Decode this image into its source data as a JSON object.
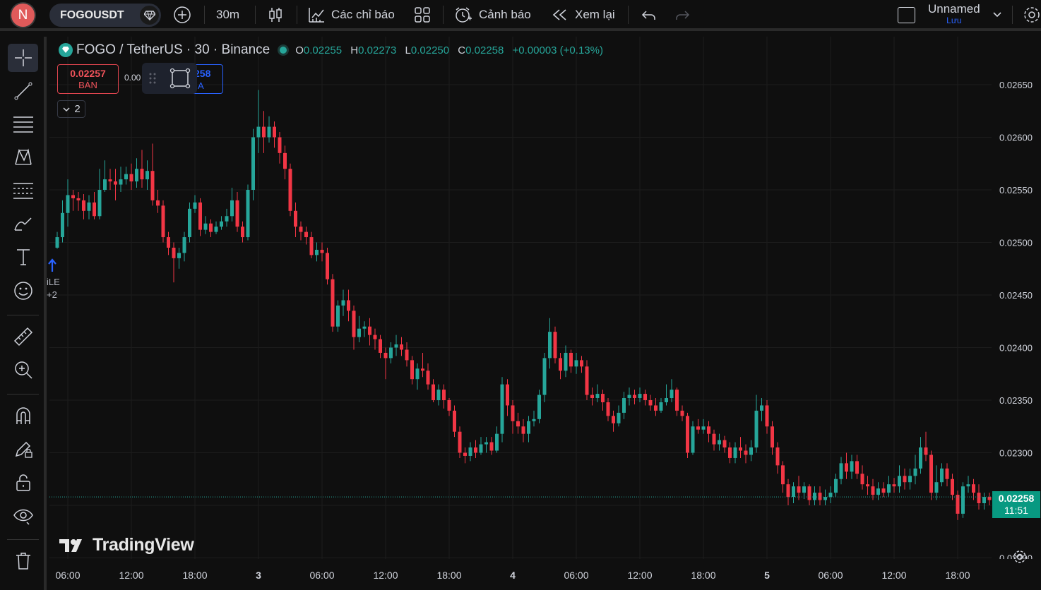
{
  "user": {
    "initial": "N"
  },
  "toolbar": {
    "symbol": "FOGOUSDT",
    "interval": "30m",
    "indicators_label": "Các chỉ báo",
    "alerts_label": "Cảnh báo",
    "replay_label": "Xem lại",
    "layout_name": "Unnamed",
    "save_label": "Lưu"
  },
  "legend": {
    "title": "FOGO / TetherUS · 30 · Binance",
    "o_label": "O",
    "o_value": "0.02255",
    "h_label": "H",
    "h_value": "0.02273",
    "l_label": "L",
    "l_value": "0.02250",
    "c_label": "C",
    "c_value": "0.02258",
    "change": "+0.00003 (+0.13%)"
  },
  "trade": {
    "sell_price": "0.02257",
    "sell_label": "BÁN",
    "spread": "0.00",
    "buy_price": "258",
    "buy_label": "A",
    "collapsed_count": "2"
  },
  "event": {
    "line1": "iLE",
    "line2": "+2"
  },
  "watermark": "TradingView",
  "current_price": {
    "value": "0.02258",
    "countdown": "11:51"
  },
  "colors": {
    "up": "#26a69a",
    "down": "#f23645",
    "bg": "#0f0f0f",
    "grid": "#1c1c1c",
    "accent": "#2962ff"
  },
  "chart_data": {
    "type": "candlestick",
    "ylim": [
      0.0222,
      0.0267
    ],
    "y_ticks": [
      "0.02650",
      "0.02600",
      "0.02550",
      "0.02500",
      "0.02450",
      "0.02400",
      "0.02350",
      "0.02300",
      "0.02250",
      "0.02200"
    ],
    "x_ticks": [
      "06:00",
      "12:00",
      "18:00",
      "3",
      "06:00",
      "12:00",
      "18:00",
      "4",
      "06:00",
      "12:00",
      "18:00",
      "5",
      "06:00",
      "12:00",
      "18:00"
    ],
    "bars_per_tick": 12,
    "first_tick_bar": 2,
    "candles": [
      [
        0.02495,
        0.02505,
        0.02494,
        0.0251
      ],
      [
        0.02505,
        0.02528,
        0.025,
        0.0254
      ],
      [
        0.02528,
        0.02545,
        0.02515,
        0.0256
      ],
      [
        0.02545,
        0.02542,
        0.0253,
        0.0255
      ],
      [
        0.02542,
        0.0254,
        0.0253,
        0.02548
      ],
      [
        0.0254,
        0.0253,
        0.02522,
        0.02546
      ],
      [
        0.0253,
        0.02538,
        0.02522,
        0.02545
      ],
      [
        0.02538,
        0.02525,
        0.02522,
        0.02548
      ],
      [
        0.02525,
        0.0255,
        0.02522,
        0.0257
      ],
      [
        0.0255,
        0.0256,
        0.02548,
        0.02578
      ],
      [
        0.0256,
        0.02558,
        0.0255,
        0.0257
      ],
      [
        0.02558,
        0.02555,
        0.0254,
        0.0257
      ],
      [
        0.02555,
        0.0256,
        0.02548,
        0.02572
      ],
      [
        0.0256,
        0.02565,
        0.02555,
        0.02572
      ],
      [
        0.02565,
        0.02558,
        0.0255,
        0.02575
      ],
      [
        0.02558,
        0.0257,
        0.02552,
        0.0258
      ],
      [
        0.0257,
        0.0256,
        0.02552,
        0.02588
      ],
      [
        0.0256,
        0.02568,
        0.0255,
        0.02578
      ],
      [
        0.02568,
        0.0254,
        0.02535,
        0.02594
      ],
      [
        0.0254,
        0.02535,
        0.02528,
        0.0255
      ],
      [
        0.02535,
        0.02505,
        0.025,
        0.0254
      ],
      [
        0.02505,
        0.02495,
        0.02488,
        0.0251
      ],
      [
        0.02495,
        0.02485,
        0.02462,
        0.025
      ],
      [
        0.02485,
        0.0249,
        0.02475,
        0.02495
      ],
      [
        0.0249,
        0.02505,
        0.02482,
        0.0251
      ],
      [
        0.02505,
        0.02532,
        0.025,
        0.02538
      ],
      [
        0.02532,
        0.02538,
        0.02528,
        0.02545
      ],
      [
        0.02538,
        0.02512,
        0.02506,
        0.02542
      ],
      [
        0.02512,
        0.02518,
        0.02508,
        0.02525
      ],
      [
        0.02518,
        0.0251,
        0.02505,
        0.02522
      ],
      [
        0.0251,
        0.02515,
        0.02508,
        0.0252
      ],
      [
        0.02515,
        0.0252,
        0.02512,
        0.02525
      ],
      [
        0.0252,
        0.02525,
        0.02515,
        0.02532
      ],
      [
        0.02525,
        0.0254,
        0.0252,
        0.02552
      ],
      [
        0.0254,
        0.02515,
        0.0251,
        0.02548
      ],
      [
        0.02515,
        0.02505,
        0.025,
        0.0252
      ],
      [
        0.02505,
        0.0255,
        0.02502,
        0.02555
      ],
      [
        0.0255,
        0.026,
        0.0254,
        0.02608
      ],
      [
        0.026,
        0.0261,
        0.02585,
        0.02645
      ],
      [
        0.0261,
        0.026,
        0.02585,
        0.02625
      ],
      [
        0.026,
        0.0261,
        0.02595,
        0.0262
      ],
      [
        0.0261,
        0.026,
        0.0259,
        0.02615
      ],
      [
        0.026,
        0.02585,
        0.02575,
        0.02605
      ],
      [
        0.02585,
        0.0257,
        0.0256,
        0.02592
      ],
      [
        0.0257,
        0.0253,
        0.02525,
        0.02575
      ],
      [
        0.0253,
        0.02515,
        0.02505,
        0.02538
      ],
      [
        0.02515,
        0.0251,
        0.02502,
        0.0252
      ],
      [
        0.0251,
        0.02505,
        0.02498,
        0.02515
      ],
      [
        0.02505,
        0.02488,
        0.02485,
        0.0251
      ],
      [
        0.02488,
        0.02493,
        0.02482,
        0.025
      ],
      [
        0.02493,
        0.0249,
        0.02482,
        0.025
      ],
      [
        0.0249,
        0.02465,
        0.0246,
        0.02495
      ],
      [
        0.02465,
        0.0242,
        0.02415,
        0.0247
      ],
      [
        0.0242,
        0.0244,
        0.02415,
        0.02445
      ],
      [
        0.0244,
        0.02445,
        0.0243,
        0.02455
      ],
      [
        0.02445,
        0.02435,
        0.02425,
        0.02455
      ],
      [
        0.02435,
        0.0241,
        0.02398,
        0.0244
      ],
      [
        0.0241,
        0.02418,
        0.02405,
        0.0243
      ],
      [
        0.02418,
        0.0242,
        0.0241,
        0.02425
      ],
      [
        0.0242,
        0.02412,
        0.02402,
        0.02428
      ],
      [
        0.02412,
        0.02408,
        0.02398,
        0.02418
      ],
      [
        0.02408,
        0.02395,
        0.0239,
        0.02412
      ],
      [
        0.02395,
        0.0239,
        0.0237,
        0.024
      ],
      [
        0.0239,
        0.024,
        0.02385,
        0.02405
      ],
      [
        0.024,
        0.02403,
        0.02392,
        0.02412
      ],
      [
        0.02403,
        0.02398,
        0.02392,
        0.0241
      ],
      [
        0.02398,
        0.02388,
        0.02382,
        0.02405
      ],
      [
        0.02388,
        0.0237,
        0.02365,
        0.02392
      ],
      [
        0.0237,
        0.0238,
        0.0236,
        0.02385
      ],
      [
        0.0238,
        0.02378,
        0.02372,
        0.02395
      ],
      [
        0.02378,
        0.02365,
        0.0236,
        0.02385
      ],
      [
        0.02365,
        0.0235,
        0.02348,
        0.0237
      ],
      [
        0.0235,
        0.0236,
        0.02345,
        0.02365
      ],
      [
        0.0236,
        0.0235,
        0.02342,
        0.02365
      ],
      [
        0.0235,
        0.0234,
        0.02335,
        0.02352
      ],
      [
        0.0234,
        0.0232,
        0.02315,
        0.02345
      ],
      [
        0.0232,
        0.023,
        0.02295,
        0.02325
      ],
      [
        0.023,
        0.02297,
        0.0229,
        0.02305
      ],
      [
        0.02297,
        0.02305,
        0.02292,
        0.0231
      ],
      [
        0.02305,
        0.023,
        0.02295,
        0.02312
      ],
      [
        0.023,
        0.02308,
        0.02298,
        0.02315
      ],
      [
        0.02308,
        0.0231,
        0.023,
        0.02315
      ],
      [
        0.0231,
        0.02302,
        0.02298,
        0.02315
      ],
      [
        0.02302,
        0.02318,
        0.023,
        0.02325
      ],
      [
        0.02318,
        0.02365,
        0.0231,
        0.02372
      ],
      [
        0.02365,
        0.02345,
        0.02335,
        0.0237
      ],
      [
        0.02345,
        0.0233,
        0.02318,
        0.0235
      ],
      [
        0.0233,
        0.02325,
        0.02318,
        0.02338
      ],
      [
        0.02325,
        0.02318,
        0.0231,
        0.02332
      ],
      [
        0.02318,
        0.0233,
        0.0231,
        0.02335
      ],
      [
        0.0233,
        0.02332,
        0.02325,
        0.0234
      ],
      [
        0.02332,
        0.02355,
        0.02328,
        0.0236
      ],
      [
        0.02355,
        0.0239,
        0.02348,
        0.02395
      ],
      [
        0.0239,
        0.02415,
        0.0238,
        0.02428
      ],
      [
        0.02415,
        0.0239,
        0.02385,
        0.0242
      ],
      [
        0.0239,
        0.02378,
        0.0237,
        0.02395
      ],
      [
        0.02378,
        0.02395,
        0.02372,
        0.02402
      ],
      [
        0.02395,
        0.02382,
        0.02376,
        0.02398
      ],
      [
        0.02382,
        0.02388,
        0.02375,
        0.02395
      ],
      [
        0.02388,
        0.02382,
        0.02376,
        0.02392
      ],
      [
        0.02382,
        0.02355,
        0.0235,
        0.02388
      ],
      [
        0.02355,
        0.02352,
        0.02345,
        0.02362
      ],
      [
        0.02352,
        0.02356,
        0.02348,
        0.02365
      ],
      [
        0.02356,
        0.02348,
        0.0234,
        0.0236
      ],
      [
        0.02348,
        0.02335,
        0.0233,
        0.02352
      ],
      [
        0.02335,
        0.02328,
        0.0232,
        0.0234
      ],
      [
        0.02328,
        0.02338,
        0.02325,
        0.02345
      ],
      [
        0.02338,
        0.02352,
        0.02332,
        0.02358
      ],
      [
        0.02352,
        0.02355,
        0.02345,
        0.02362
      ],
      [
        0.02355,
        0.02352,
        0.02346,
        0.0236
      ],
      [
        0.02352,
        0.02356,
        0.02348,
        0.02362
      ],
      [
        0.02356,
        0.0235,
        0.02345,
        0.0236
      ],
      [
        0.0235,
        0.02345,
        0.0234,
        0.02355
      ],
      [
        0.02345,
        0.0234,
        0.02335,
        0.02352
      ],
      [
        0.0234,
        0.02348,
        0.02338,
        0.02352
      ],
      [
        0.02348,
        0.02352,
        0.02345,
        0.02365
      ],
      [
        0.02352,
        0.0236,
        0.02348,
        0.0237
      ],
      [
        0.0236,
        0.0234,
        0.02335,
        0.02362
      ],
      [
        0.0234,
        0.02335,
        0.0233,
        0.02345
      ],
      [
        0.02335,
        0.023,
        0.02295,
        0.02338
      ],
      [
        0.023,
        0.02325,
        0.02298,
        0.0233
      ],
      [
        0.02325,
        0.02322,
        0.02318,
        0.02332
      ],
      [
        0.02322,
        0.02325,
        0.02318,
        0.02332
      ],
      [
        0.02325,
        0.02318,
        0.0231,
        0.0233
      ],
      [
        0.02318,
        0.02308,
        0.02302,
        0.02322
      ],
      [
        0.02308,
        0.02312,
        0.02302,
        0.02318
      ],
      [
        0.02312,
        0.02305,
        0.023,
        0.02316
      ],
      [
        0.02305,
        0.02295,
        0.0229,
        0.0231
      ],
      [
        0.02295,
        0.02305,
        0.0229,
        0.0231
      ],
      [
        0.02305,
        0.02302,
        0.02295,
        0.02315
      ],
      [
        0.02302,
        0.02298,
        0.0229,
        0.02308
      ],
      [
        0.02298,
        0.02305,
        0.02292,
        0.02312
      ],
      [
        0.02305,
        0.0234,
        0.023,
        0.02355
      ],
      [
        0.0234,
        0.02345,
        0.0233,
        0.02352
      ],
      [
        0.02345,
        0.02325,
        0.02318,
        0.0235
      ],
      [
        0.02325,
        0.02305,
        0.02298,
        0.0233
      ],
      [
        0.02305,
        0.02288,
        0.0228,
        0.0231
      ],
      [
        0.02288,
        0.0227,
        0.02262,
        0.02292
      ],
      [
        0.0227,
        0.02258,
        0.0225,
        0.02275
      ],
      [
        0.02258,
        0.02268,
        0.02252,
        0.02272
      ],
      [
        0.02268,
        0.02262,
        0.02255,
        0.02278
      ],
      [
        0.02262,
        0.02268,
        0.02256,
        0.02272
      ],
      [
        0.02268,
        0.02255,
        0.0225,
        0.0227
      ],
      [
        0.02255,
        0.02262,
        0.0225,
        0.02268
      ],
      [
        0.02262,
        0.02255,
        0.0225,
        0.02268
      ],
      [
        0.02255,
        0.02258,
        0.0225,
        0.02265
      ],
      [
        0.02258,
        0.02262,
        0.02252,
        0.02268
      ],
      [
        0.02262,
        0.02275,
        0.02258,
        0.0228
      ],
      [
        0.02275,
        0.0229,
        0.0227,
        0.02296
      ],
      [
        0.0229,
        0.02282,
        0.02275,
        0.023
      ],
      [
        0.02282,
        0.02292,
        0.02275,
        0.02298
      ],
      [
        0.02292,
        0.0228,
        0.02275,
        0.02298
      ],
      [
        0.0228,
        0.0227,
        0.02265,
        0.02288
      ],
      [
        0.0227,
        0.02268,
        0.0226,
        0.02278
      ],
      [
        0.02268,
        0.0226,
        0.02255,
        0.02275
      ],
      [
        0.0226,
        0.02266,
        0.02255,
        0.02272
      ],
      [
        0.02266,
        0.02262,
        0.02258,
        0.02272
      ],
      [
        0.02262,
        0.0227,
        0.02258,
        0.02278
      ],
      [
        0.0227,
        0.02268,
        0.02262,
        0.02276
      ],
      [
        0.02268,
        0.02278,
        0.02262,
        0.02288
      ],
      [
        0.02278,
        0.02272,
        0.02265,
        0.02285
      ],
      [
        0.02272,
        0.02278,
        0.02265,
        0.02285
      ],
      [
        0.02278,
        0.02285,
        0.0227,
        0.02298
      ],
      [
        0.02285,
        0.02305,
        0.0228,
        0.02315
      ],
      [
        0.02305,
        0.02298,
        0.02292,
        0.0232
      ],
      [
        0.02298,
        0.02262,
        0.02255,
        0.02302
      ],
      [
        0.02262,
        0.02272,
        0.02255,
        0.02288
      ],
      [
        0.02272,
        0.02285,
        0.02268,
        0.0229
      ],
      [
        0.02285,
        0.02275,
        0.02268,
        0.0229
      ],
      [
        0.02275,
        0.0226,
        0.02255,
        0.0228
      ],
      [
        0.0226,
        0.02242,
        0.02236,
        0.02264
      ],
      [
        0.02242,
        0.02268,
        0.02238,
        0.02272
      ],
      [
        0.02268,
        0.0227,
        0.02262,
        0.02278
      ],
      [
        0.0227,
        0.02262,
        0.02255,
        0.02275
      ],
      [
        0.02262,
        0.02252,
        0.02246,
        0.0227
      ],
      [
        0.02252,
        0.02258,
        0.02246,
        0.02262
      ],
      [
        0.02258,
        0.02255,
        0.0225,
        0.02262
      ],
      [
        0.02255,
        0.02262,
        0.02248,
        0.02265
      ],
      [
        0.02262,
        0.02255,
        0.02245,
        0.02268
      ],
      [
        0.02255,
        0.02268,
        0.0225,
        0.02272
      ],
      [
        0.02268,
        0.02278,
        0.02262,
        0.02285
      ],
      [
        0.02278,
        0.02295,
        0.02272,
        0.02302
      ],
      [
        0.02295,
        0.0228,
        0.02262,
        0.02308
      ],
      [
        0.0228,
        0.0226,
        0.02255,
        0.02285
      ],
      [
        0.02255,
        0.02258,
        0.0225,
        0.02273
      ]
    ]
  }
}
